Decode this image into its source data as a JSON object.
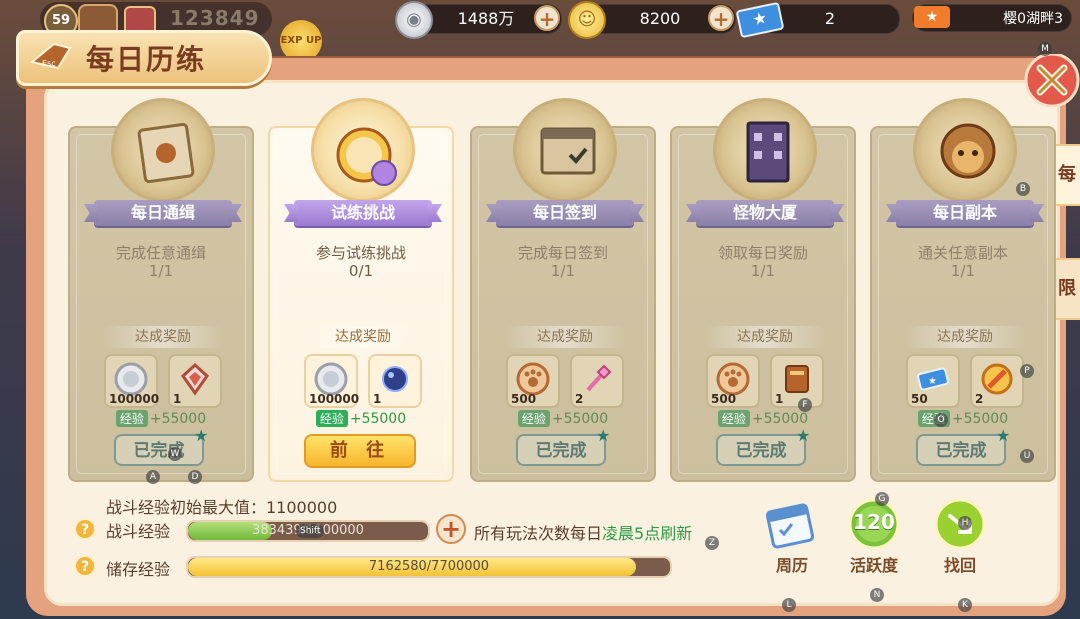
{
  "top": {
    "level": "59",
    "score": "123849",
    "silver": "1488万",
    "gold": "8200",
    "tickets": "2",
    "news": "樱0湖畔3"
  },
  "title": "每日历练",
  "side_tabs": [
    "每",
    "限"
  ],
  "cards": [
    {
      "name": "每日通缉",
      "desc": "完成任意通缉",
      "progress": "1/1",
      "rewards": [
        {
          "icon": "silver-coin-icon",
          "count": "100000"
        },
        {
          "icon": "red-crystal-icon",
          "count": "1"
        }
      ],
      "exp_tag": "经验",
      "exp": "+55000",
      "state": "已完成"
    },
    {
      "name": "试练挑战",
      "desc": "参与试练挑战",
      "progress": "0/1",
      "rewards": [
        {
          "icon": "silver-coin-icon",
          "count": "100000"
        },
        {
          "icon": "blue-orb-icon",
          "count": "1"
        }
      ],
      "exp_tag": "经验",
      "exp": "+55000",
      "state": "前 往"
    },
    {
      "name": "每日签到",
      "desc": "完成每日签到",
      "progress": "1/1",
      "rewards": [
        {
          "icon": "paw-coin-icon",
          "count": "500"
        },
        {
          "icon": "crystal-wand-icon",
          "count": "2"
        }
      ],
      "exp_tag": "经验",
      "exp": "+55000",
      "state": "已完成"
    },
    {
      "name": "怪物大厦",
      "desc": "领取每日奖励",
      "progress": "1/1",
      "rewards": [
        {
          "icon": "paw-coin-icon",
          "count": "500"
        },
        {
          "icon": "book-icon",
          "count": "1"
        }
      ],
      "exp_tag": "经验",
      "exp": "+55000",
      "state": "已完成"
    },
    {
      "name": "每日副本",
      "desc": "通关任意副本",
      "progress": "1/1",
      "rewards": [
        {
          "icon": "ticket-icon",
          "count": "50"
        },
        {
          "icon": "gold-stick-icon",
          "count": "2"
        }
      ],
      "exp_tag": "经验",
      "exp": "+55000",
      "state": "已完成"
    }
  ],
  "reward_label": "达成奖励",
  "bottom": {
    "max_exp_label": "战斗经验初始最大值：1100000",
    "battle_exp_label": "战斗经验",
    "battle_exp_text": "383439/1100000",
    "battle_exp_ratio": 0.35,
    "store_exp_label": "储存经验",
    "store_exp_text": "7162580/7700000",
    "store_exp_ratio": 0.93,
    "refresh_prefix": "所有玩法次数每日",
    "refresh_highlight": "凌晨5点刷新",
    "actions": [
      {
        "label": "周历",
        "icon": "calendar-icon"
      },
      {
        "label": "活跃度",
        "value": "120",
        "icon": "activity-icon"
      },
      {
        "label": "找回",
        "icon": "retrieve-icon"
      }
    ]
  },
  "hotkeys": [
    "M",
    "B",
    "P",
    "U",
    "G",
    "N",
    "K",
    "L",
    "A",
    "D",
    "W",
    "F",
    "O",
    "Z",
    "H",
    "Shift"
  ],
  "colors": {
    "accent": "#e5a27f",
    "green": "#2f9a45",
    "purple": "#9b7bd1",
    "gold": "#f7b52c"
  }
}
